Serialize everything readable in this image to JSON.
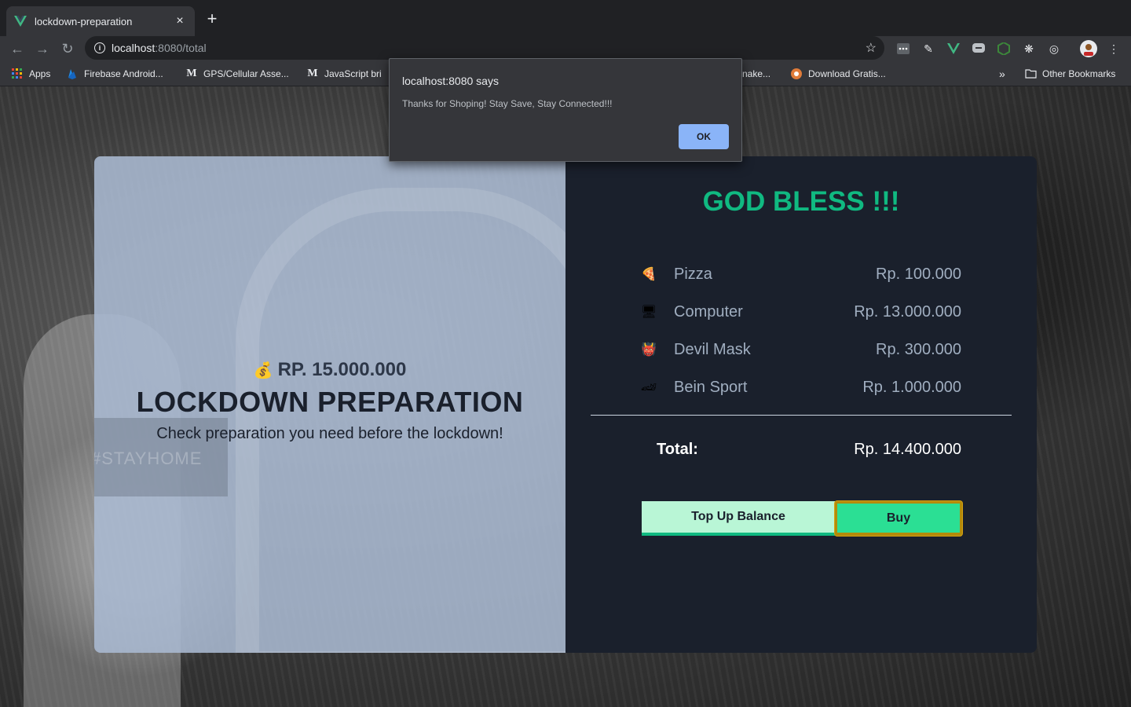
{
  "browser": {
    "tab_title": "lockdown-preparation",
    "close_symbol": "×",
    "new_tab_symbol": "+",
    "url_host": "localhost",
    "url_path": ":8080/total",
    "bookmarks": [
      {
        "label": "Apps",
        "icon": "apps-grid-icon"
      },
      {
        "label": "Firebase Android...",
        "icon": "firebase-icon"
      },
      {
        "label": "GPS/Cellular Asse...",
        "icon": "medium-icon"
      },
      {
        "label": "JavaScript bri",
        "icon": "medium-icon"
      },
      {
        "label": "nake...",
        "icon": "generic-icon"
      },
      {
        "label": "Download Gratis...",
        "icon": "download-site-icon"
      }
    ],
    "more_bookmarks": "»",
    "other_bookmarks": "Other Bookmarks"
  },
  "dialog": {
    "title": "localhost:8080 says",
    "message": "Thanks for Shoping! Stay Save, Stay Connected!!!",
    "ok_label": "OK"
  },
  "hero": {
    "balance_icon": "💰",
    "balance": "RP. 15.000.000",
    "title": "LOCKDOWN PREPARATION",
    "subtitle": "Check preparation you need before the lockdown!",
    "background_text": "#STAYHOME"
  },
  "cart": {
    "heading": "GOD BLESS !!!",
    "items": [
      {
        "icon": "🍕",
        "name": "Pizza",
        "price": "Rp. 100.000"
      },
      {
        "icon": "🖥",
        "name": "Computer",
        "price": "Rp. 13.000.000"
      },
      {
        "icon": "👹",
        "name": "Devil Mask",
        "price": "Rp. 300.000"
      },
      {
        "icon": "🏎",
        "name": "Bein Sport",
        "price": "Rp. 1.000.000"
      }
    ],
    "total_label": "Total:",
    "total_value": "Rp. 14.400.000",
    "topup_label": "Top Up Balance",
    "buy_label": "Buy"
  },
  "colors": {
    "accent_green": "#10b981",
    "button_green": "#2bdf94",
    "panel_dark": "#1a202c",
    "dialog_button": "#8ab4f8"
  }
}
